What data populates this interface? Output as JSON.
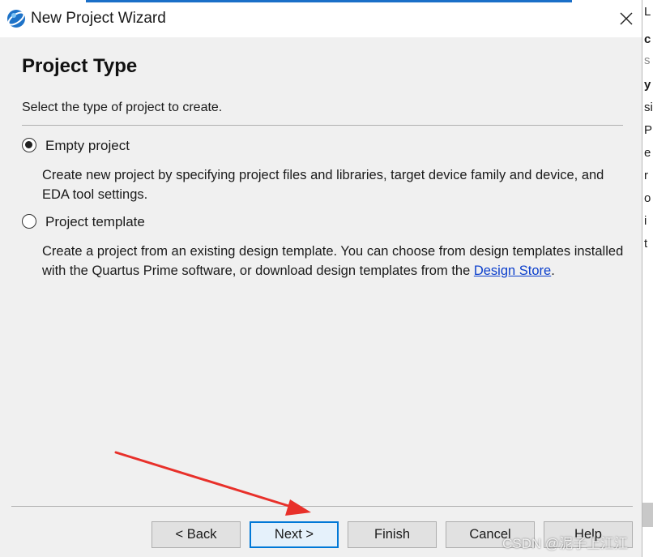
{
  "window": {
    "title": "New Project Wizard",
    "app_icon": "quartus-globe-icon",
    "close_icon": "close-icon"
  },
  "page": {
    "title": "Project Type",
    "instructions": "Select the type of project to create."
  },
  "options": [
    {
      "label": "Empty project",
      "selected": true,
      "description": "Create new project by specifying project files and libraries, target device family and device, and EDA tool settings."
    },
    {
      "label": "Project template",
      "selected": false,
      "description_prefix": "Create a project from an existing design template. You can choose from design templates installed with the Quartus Prime software, or download design templates from the ",
      "link_text": "Design Store",
      "description_suffix": "."
    }
  ],
  "buttons": {
    "back": "< Back",
    "next": "Next >",
    "finish": "Finish",
    "cancel": "Cancel",
    "help": "Help"
  },
  "background_window_fragments": [
    "L",
    "c",
    "s",
    "y",
    "si",
    "P",
    "e",
    "r",
    "o",
    "i",
    "t"
  ],
  "watermark": "CSDN @泥子上江江",
  "colors": {
    "accent": "#0078d7",
    "link": "#0b3fcc",
    "annotation_arrow": "#e8302a",
    "dialog_bg": "#f0f0f0"
  }
}
